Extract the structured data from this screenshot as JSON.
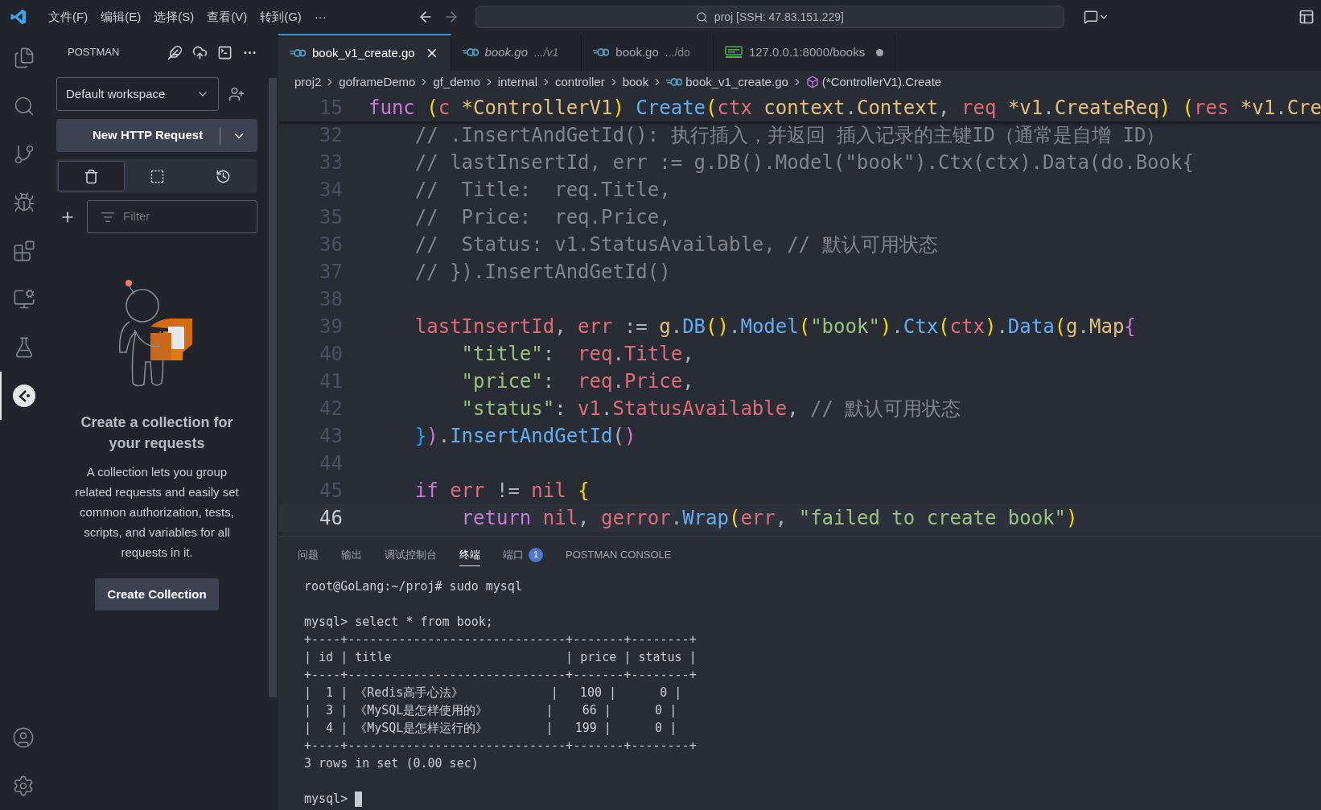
{
  "title_bar": {
    "menus": [
      "文件(F)",
      "编辑(E)",
      "选择(S)",
      "查看(V)",
      "转到(G)",
      "···"
    ],
    "search": "proj [SSH: 47.83.151.229]"
  },
  "activity_bar": {
    "items": [
      {
        "kind": "files",
        "selected": false
      },
      {
        "kind": "search",
        "selected": false
      },
      {
        "kind": "source-control",
        "selected": false
      },
      {
        "kind": "run-debug",
        "selected": false
      },
      {
        "kind": "extensions",
        "selected": false
      },
      {
        "kind": "remote",
        "selected": false
      },
      {
        "kind": "testing",
        "selected": false
      },
      {
        "kind": "postman",
        "selected": true
      }
    ],
    "bottom": [
      {
        "kind": "account"
      },
      {
        "kind": "settings"
      }
    ]
  },
  "sidebar": {
    "title": "POSTMAN",
    "workspace": "Default workspace",
    "new_request_button": "New HTTP Request",
    "views": [
      {
        "kind": "collections",
        "selected": true
      },
      {
        "kind": "environments",
        "selected": false
      },
      {
        "kind": "history",
        "selected": false
      }
    ],
    "filter": {
      "placeholder": "Filter"
    },
    "empty_state": {
      "heading": "Create a collection for your requests",
      "text": "A collection lets you group related requests and easily set common authorization, tests, scripts, and variables for all requests in it.",
      "button": "Create Collection"
    }
  },
  "tabs": [
    {
      "kind": "go",
      "label": "book_v1_create.go",
      "selected": true,
      "preview": false,
      "modified": false
    },
    {
      "kind": "go",
      "label": "book.go",
      "detail": ".../v1",
      "selected": false,
      "preview": true,
      "modified": false
    },
    {
      "kind": "go",
      "label": "book.go",
      "detail": ".../do",
      "selected": false,
      "preview": false,
      "modified": false
    },
    {
      "kind": "http",
      "label": "127.0.0.1:8000/books",
      "selected": false,
      "preview": false,
      "modified": true
    }
  ],
  "breadcrumb": [
    {
      "kind": "folder",
      "label": "proj2"
    },
    {
      "kind": "folder",
      "label": "goframeDemo"
    },
    {
      "kind": "folder",
      "label": "gf_demo"
    },
    {
      "kind": "folder",
      "label": "internal"
    },
    {
      "kind": "folder",
      "label": "controller"
    },
    {
      "kind": "folder",
      "label": "book"
    },
    {
      "kind": "file",
      "label": "book_v1_create.go"
    },
    {
      "kind": "symbol",
      "label": "(*ControllerV1).Create"
    }
  ],
  "editor": {
    "sticky_line": {
      "number": "15",
      "code": "func (c *ControllerV1) Create(ctx context.Context, req *v1.CreateReq) (res *v1.Cre"
    },
    "lines": [
      {
        "number": "32",
        "current": false,
        "code": "    // .InsertAndGetId(): 执行插入，并返回 插入记录的主键ID（通常是自增 ID）"
      },
      {
        "number": "33",
        "current": false,
        "code": "    // lastInsertId, err := g.DB().Model(\"book\").Ctx(ctx).Data(do.Book{"
      },
      {
        "number": "34",
        "current": false,
        "code": "    //  Title:  req.Title,"
      },
      {
        "number": "35",
        "current": false,
        "code": "    //  Price:  req.Price,"
      },
      {
        "number": "36",
        "current": false,
        "code": "    //  Status: v1.StatusAvailable, // 默认可用状态"
      },
      {
        "number": "37",
        "current": false,
        "code": "    // }).InsertAndGetId()"
      },
      {
        "number": "38",
        "current": false
      },
      {
        "number": "39",
        "current": false,
        "code": "    lastInsertId, err := g.DB().Model(\"book\").Ctx(ctx).Data(g.Map{"
      },
      {
        "number": "40",
        "current": false,
        "code": "        \"title\":  req.Title,"
      },
      {
        "number": "41",
        "current": false,
        "code": "        \"price\":  req.Price,"
      },
      {
        "number": "42",
        "current": false,
        "code": "        \"status\": v1.StatusAvailable, // 默认可用状态"
      },
      {
        "number": "43",
        "current": false,
        "code": "    }).InsertAndGetId()"
      },
      {
        "number": "44",
        "current": false
      },
      {
        "number": "45",
        "current": false,
        "code": "    if err != nil {"
      },
      {
        "number": "46",
        "current": true,
        "code": "        return nil, gerror.Wrap(err, \"failed to create book\")"
      }
    ]
  },
  "panel": {
    "tabs": [
      {
        "label": "问题",
        "selected": false
      },
      {
        "label": "输出",
        "selected": false
      },
      {
        "label": "调试控制台",
        "selected": false
      },
      {
        "label": "终端",
        "selected": true
      },
      {
        "label": "端口",
        "badge": "1",
        "selected": false
      },
      {
        "label": "POSTMAN CONSOLE",
        "selected": false
      }
    ],
    "terminal": {
      "blocks": [
        [
          "root@GoLang:~/proj# sudo mysql"
        ],
        [
          "mysql> select * from book;",
          "+----+------------------------------+-------+--------+",
          "| id | title                        | price | status |",
          "+----+------------------------------+-------+--------+",
          "|  1 | 《Redis高手心法》            |   100 |      0 |",
          "|  3 | 《MySQL是怎样使用的》        |    66 |      0 |",
          "|  4 | 《MySQL是怎样运行的》        |   199 |      0 |",
          "+----+------------------------------+-------+--------+",
          "3 rows in set (0.00 sec)"
        ],
        [
          "mysql> "
        ]
      ],
      "cursor": true
    }
  }
}
